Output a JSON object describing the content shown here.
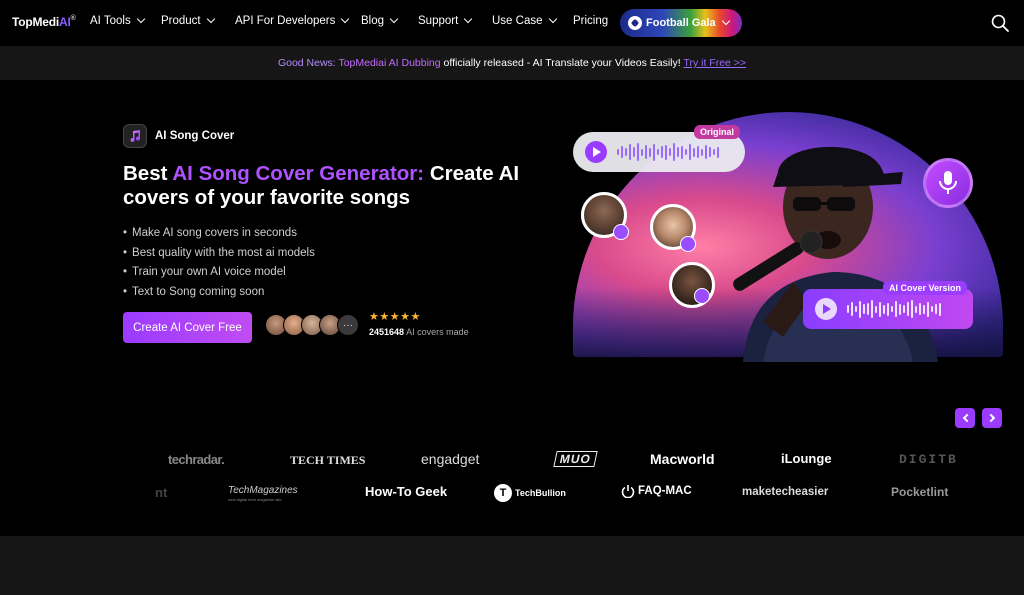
{
  "nav": {
    "logo_main": "TopMedi",
    "logo_ai": "AI",
    "logo_reg": "®",
    "items": [
      {
        "label": "AI Tools"
      },
      {
        "label": "Product"
      },
      {
        "label": "API For Developers"
      },
      {
        "label": "Blog"
      },
      {
        "label": "Support"
      },
      {
        "label": "Use Case"
      },
      {
        "label": "Pricing"
      }
    ],
    "promo_label": "Football Gala",
    "search_icon": "search-icon"
  },
  "banner": {
    "good": "Good News:",
    "product": "TopMediai AI Dubbing",
    "mid": "officially released - AI Translate your Videos Easily!",
    "link": "Try it Free >>"
  },
  "hero": {
    "badge": "AI Song Cover",
    "headline_pre": "Best ",
    "headline_highlight": "AI Song Cover Generator:",
    "headline_post": " Create AI covers of your favorite songs",
    "features": [
      "Make AI song covers in seconds",
      "Best quality with the most ai models",
      "Train your own AI voice model",
      "Text to Song coming soon"
    ],
    "cta": "Create AI Cover Free",
    "more_avatars": "···",
    "rating": "★★★★★",
    "rating_value": 5,
    "covers_count": "2451648",
    "covers_suffix": "AI covers made"
  },
  "art": {
    "original_tag": "Original",
    "ai_tag": "AI Cover Version"
  },
  "press_row1": [
    "techradar.",
    "TECH TIMES",
    "engadget",
    "MUO",
    "Macworld",
    "iLounge",
    "DIGITB"
  ],
  "press_row2": [
    "nt",
    "TechMagazines",
    "How-To Geek",
    "TechBullion",
    "FAQ-MAC",
    "maketecheasier",
    "Pocketlint"
  ],
  "press_sub": "next digital tech magazine site",
  "colors": {
    "accent": "#9b3bff",
    "headline_highlight": "#b052ff",
    "background": "#000000",
    "banner_bg": "#161616",
    "star": "#ffb62e"
  }
}
